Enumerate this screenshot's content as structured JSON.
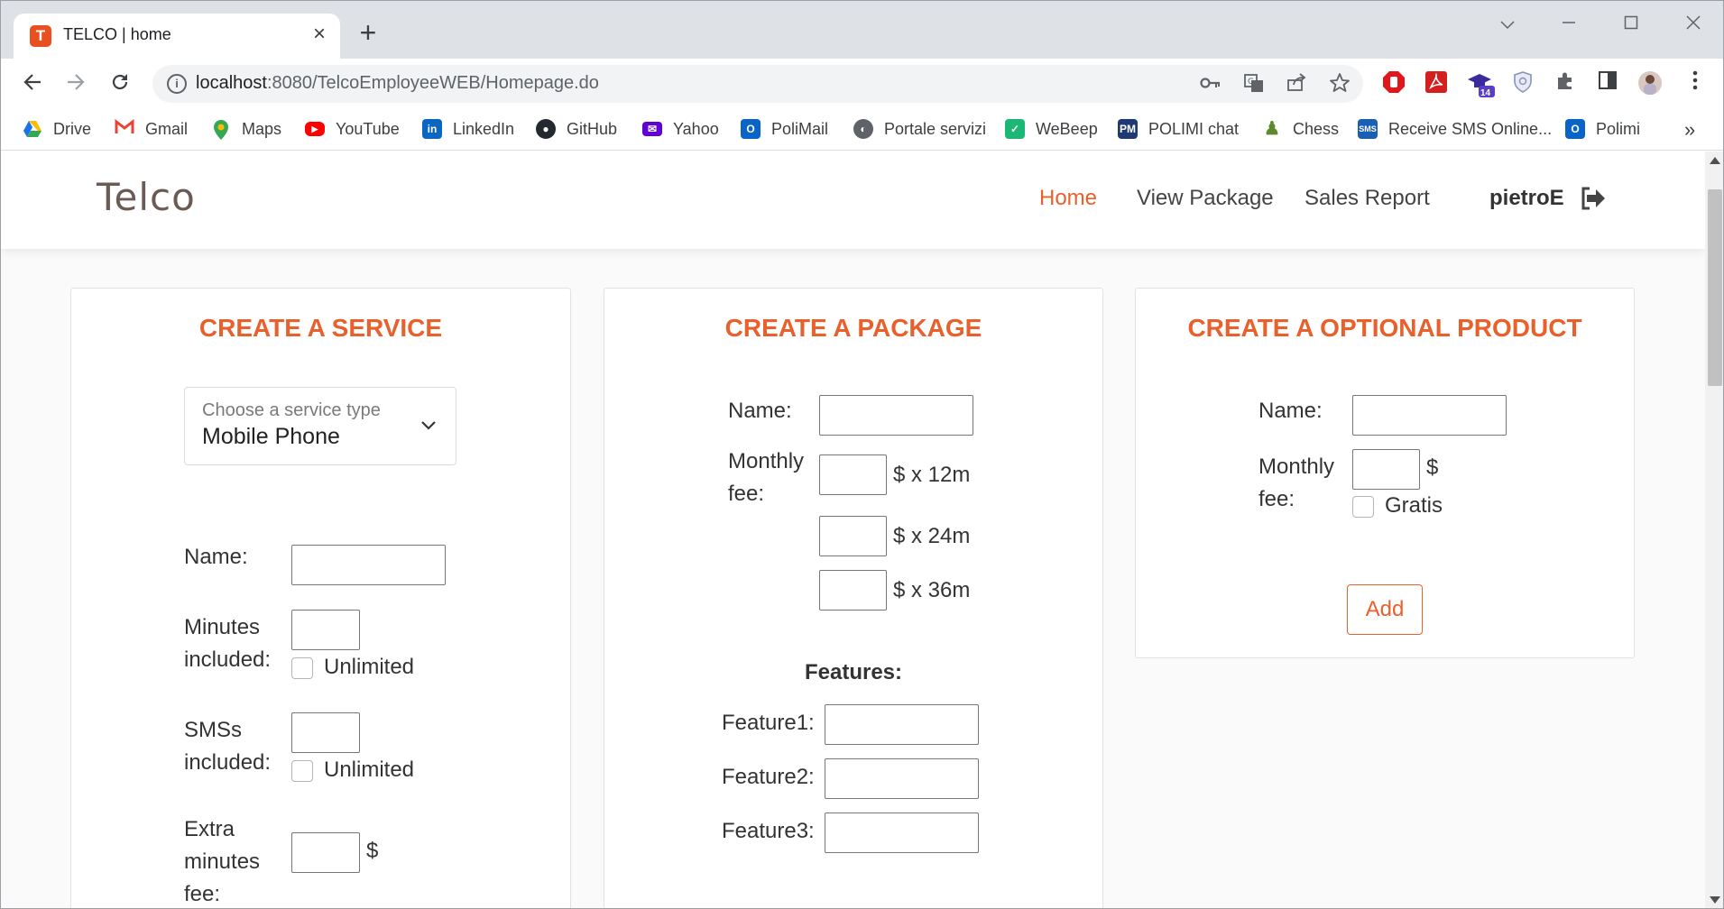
{
  "browser": {
    "tab_title": "TELCO | home",
    "tab_favicon_letter": "T",
    "url_host": "localhost",
    "url_path": ":8080/TelcoEmployeeWEB/Homepage.do",
    "bookmarks": [
      "Drive",
      "Gmail",
      "Maps",
      "YouTube",
      "LinkedIn",
      "GitHub",
      "Yahoo",
      "PoliMail",
      "Portale servizi",
      "WeBeep",
      "POLIMI chat",
      "Chess",
      "Receive SMS Online...",
      "Polimi"
    ],
    "extension_badge": "14"
  },
  "header": {
    "brand": "Telco",
    "nav": [
      "Home",
      "View Package",
      "Sales Report"
    ],
    "username": "pietroE"
  },
  "service": {
    "title": "CREATE A SERVICE",
    "select_placeholder": "Choose a service type",
    "select_value": "Mobile Phone",
    "name_label": "Name:",
    "minutes_label": [
      "Minutes",
      "included:"
    ],
    "sms_label": [
      "SMSs",
      "included:"
    ],
    "unlimited": "Unlimited",
    "extra_label": [
      "Extra",
      "minutes",
      "fee:"
    ],
    "currency": "$"
  },
  "package": {
    "title": "CREATE A PACKAGE",
    "name_label": "Name:",
    "fee_label": [
      "Monthly",
      "fee:"
    ],
    "periods": [
      "$ x 12m",
      "$ x 24m",
      "$ x 36m"
    ],
    "features_heading": "Features:",
    "features": [
      "Feature1:",
      "Feature2:",
      "Feature3:"
    ]
  },
  "optional": {
    "title": "CREATE A OPTIONAL PRODUCT",
    "name_label": "Name:",
    "fee_label": [
      "Monthly",
      "fee:"
    ],
    "currency": "$",
    "gratis": "Gratis",
    "add_button": "Add"
  },
  "colors": {
    "accent": "#e8602c",
    "brand": "#6b5b55"
  }
}
